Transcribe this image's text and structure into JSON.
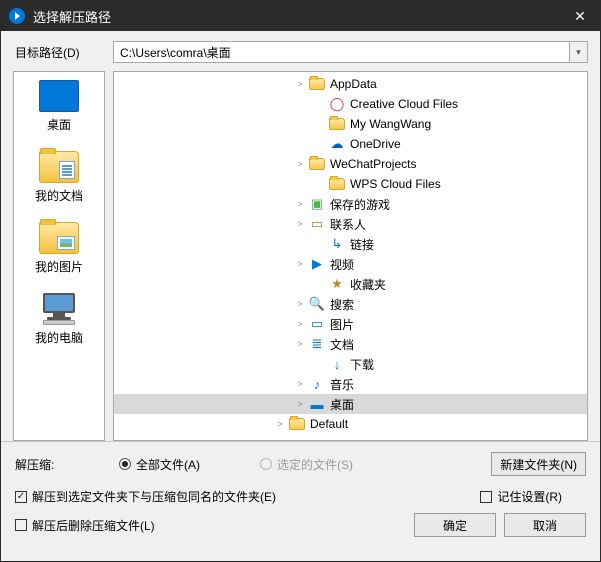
{
  "title": "选择解压路径",
  "path": {
    "label": "目标路径(D)",
    "value": "C:\\Users\\comra\\桌面"
  },
  "places": [
    {
      "key": "desktop",
      "label": "桌面"
    },
    {
      "key": "documents",
      "label": "我的文档"
    },
    {
      "key": "pictures",
      "label": "我的图片"
    },
    {
      "key": "computer",
      "label": "我的电脑"
    }
  ],
  "tree": [
    {
      "indent": 9,
      "expand": ">",
      "icon": "folder",
      "label": "AppData"
    },
    {
      "indent": 10,
      "expand": "",
      "icon": "cc",
      "label": "Creative Cloud Files"
    },
    {
      "indent": 10,
      "expand": "",
      "icon": "folder",
      "label": "My WangWang"
    },
    {
      "indent": 10,
      "expand": "",
      "icon": "onedrive",
      "label": "OneDrive"
    },
    {
      "indent": 9,
      "expand": ">",
      "icon": "folder",
      "label": "WeChatProjects"
    },
    {
      "indent": 10,
      "expand": "",
      "icon": "folder",
      "label": "WPS Cloud Files"
    },
    {
      "indent": 9,
      "expand": ">",
      "icon": "game",
      "label": "保存的游戏"
    },
    {
      "indent": 9,
      "expand": ">",
      "icon": "contacts",
      "label": "联系人"
    },
    {
      "indent": 10,
      "expand": "",
      "icon": "link",
      "label": "链接"
    },
    {
      "indent": 9,
      "expand": ">",
      "icon": "video",
      "label": "视频"
    },
    {
      "indent": 10,
      "expand": "",
      "icon": "star",
      "label": "收藏夹"
    },
    {
      "indent": 9,
      "expand": ">",
      "icon": "search",
      "label": "搜索"
    },
    {
      "indent": 9,
      "expand": ">",
      "icon": "pic",
      "label": "图片"
    },
    {
      "indent": 9,
      "expand": ">",
      "icon": "doc",
      "label": "文档"
    },
    {
      "indent": 10,
      "expand": "",
      "icon": "down",
      "label": "下载"
    },
    {
      "indent": 9,
      "expand": ">",
      "icon": "music",
      "label": "音乐"
    },
    {
      "indent": 9,
      "expand": ">",
      "icon": "desktop",
      "label": "桌面",
      "selected": true
    },
    {
      "indent": 8,
      "expand": ">",
      "icon": "folder",
      "label": "Default"
    }
  ],
  "extract": {
    "label": "解压缩:",
    "all": "全部文件(A)",
    "selected": "选定的文件(S)",
    "newFolder": "新建文件夹(N)"
  },
  "opts": {
    "sameName": "解压到选定文件夹下与压缩包同名的文件夹(E)",
    "remember": "记住设置(R)",
    "deleteAfter": "解压后删除压缩文件(L)"
  },
  "buttons": {
    "ok": "确定",
    "cancel": "取消"
  },
  "iconGlyph": {
    "cc": "◯",
    "onedrive": "☁",
    "game": "▣",
    "contacts": "▭",
    "link": "↳",
    "video": "▶",
    "star": "★",
    "search": "🔍",
    "pic": "▭",
    "doc": "≣",
    "down": "↓",
    "music": "♪",
    "desktop": "▬"
  },
  "iconColor": {
    "cc": "#da1f26",
    "onedrive": "#0364b8",
    "game": "#4caf50",
    "contacts": "#b08030",
    "link": "#0078d7",
    "video": "#0078d7",
    "star": "#c08b1e",
    "search": "#0078d7",
    "pic": "#0078d7",
    "doc": "#0078d7",
    "down": "#0078d7",
    "music": "#0078d7",
    "desktop": "#0078d7"
  }
}
